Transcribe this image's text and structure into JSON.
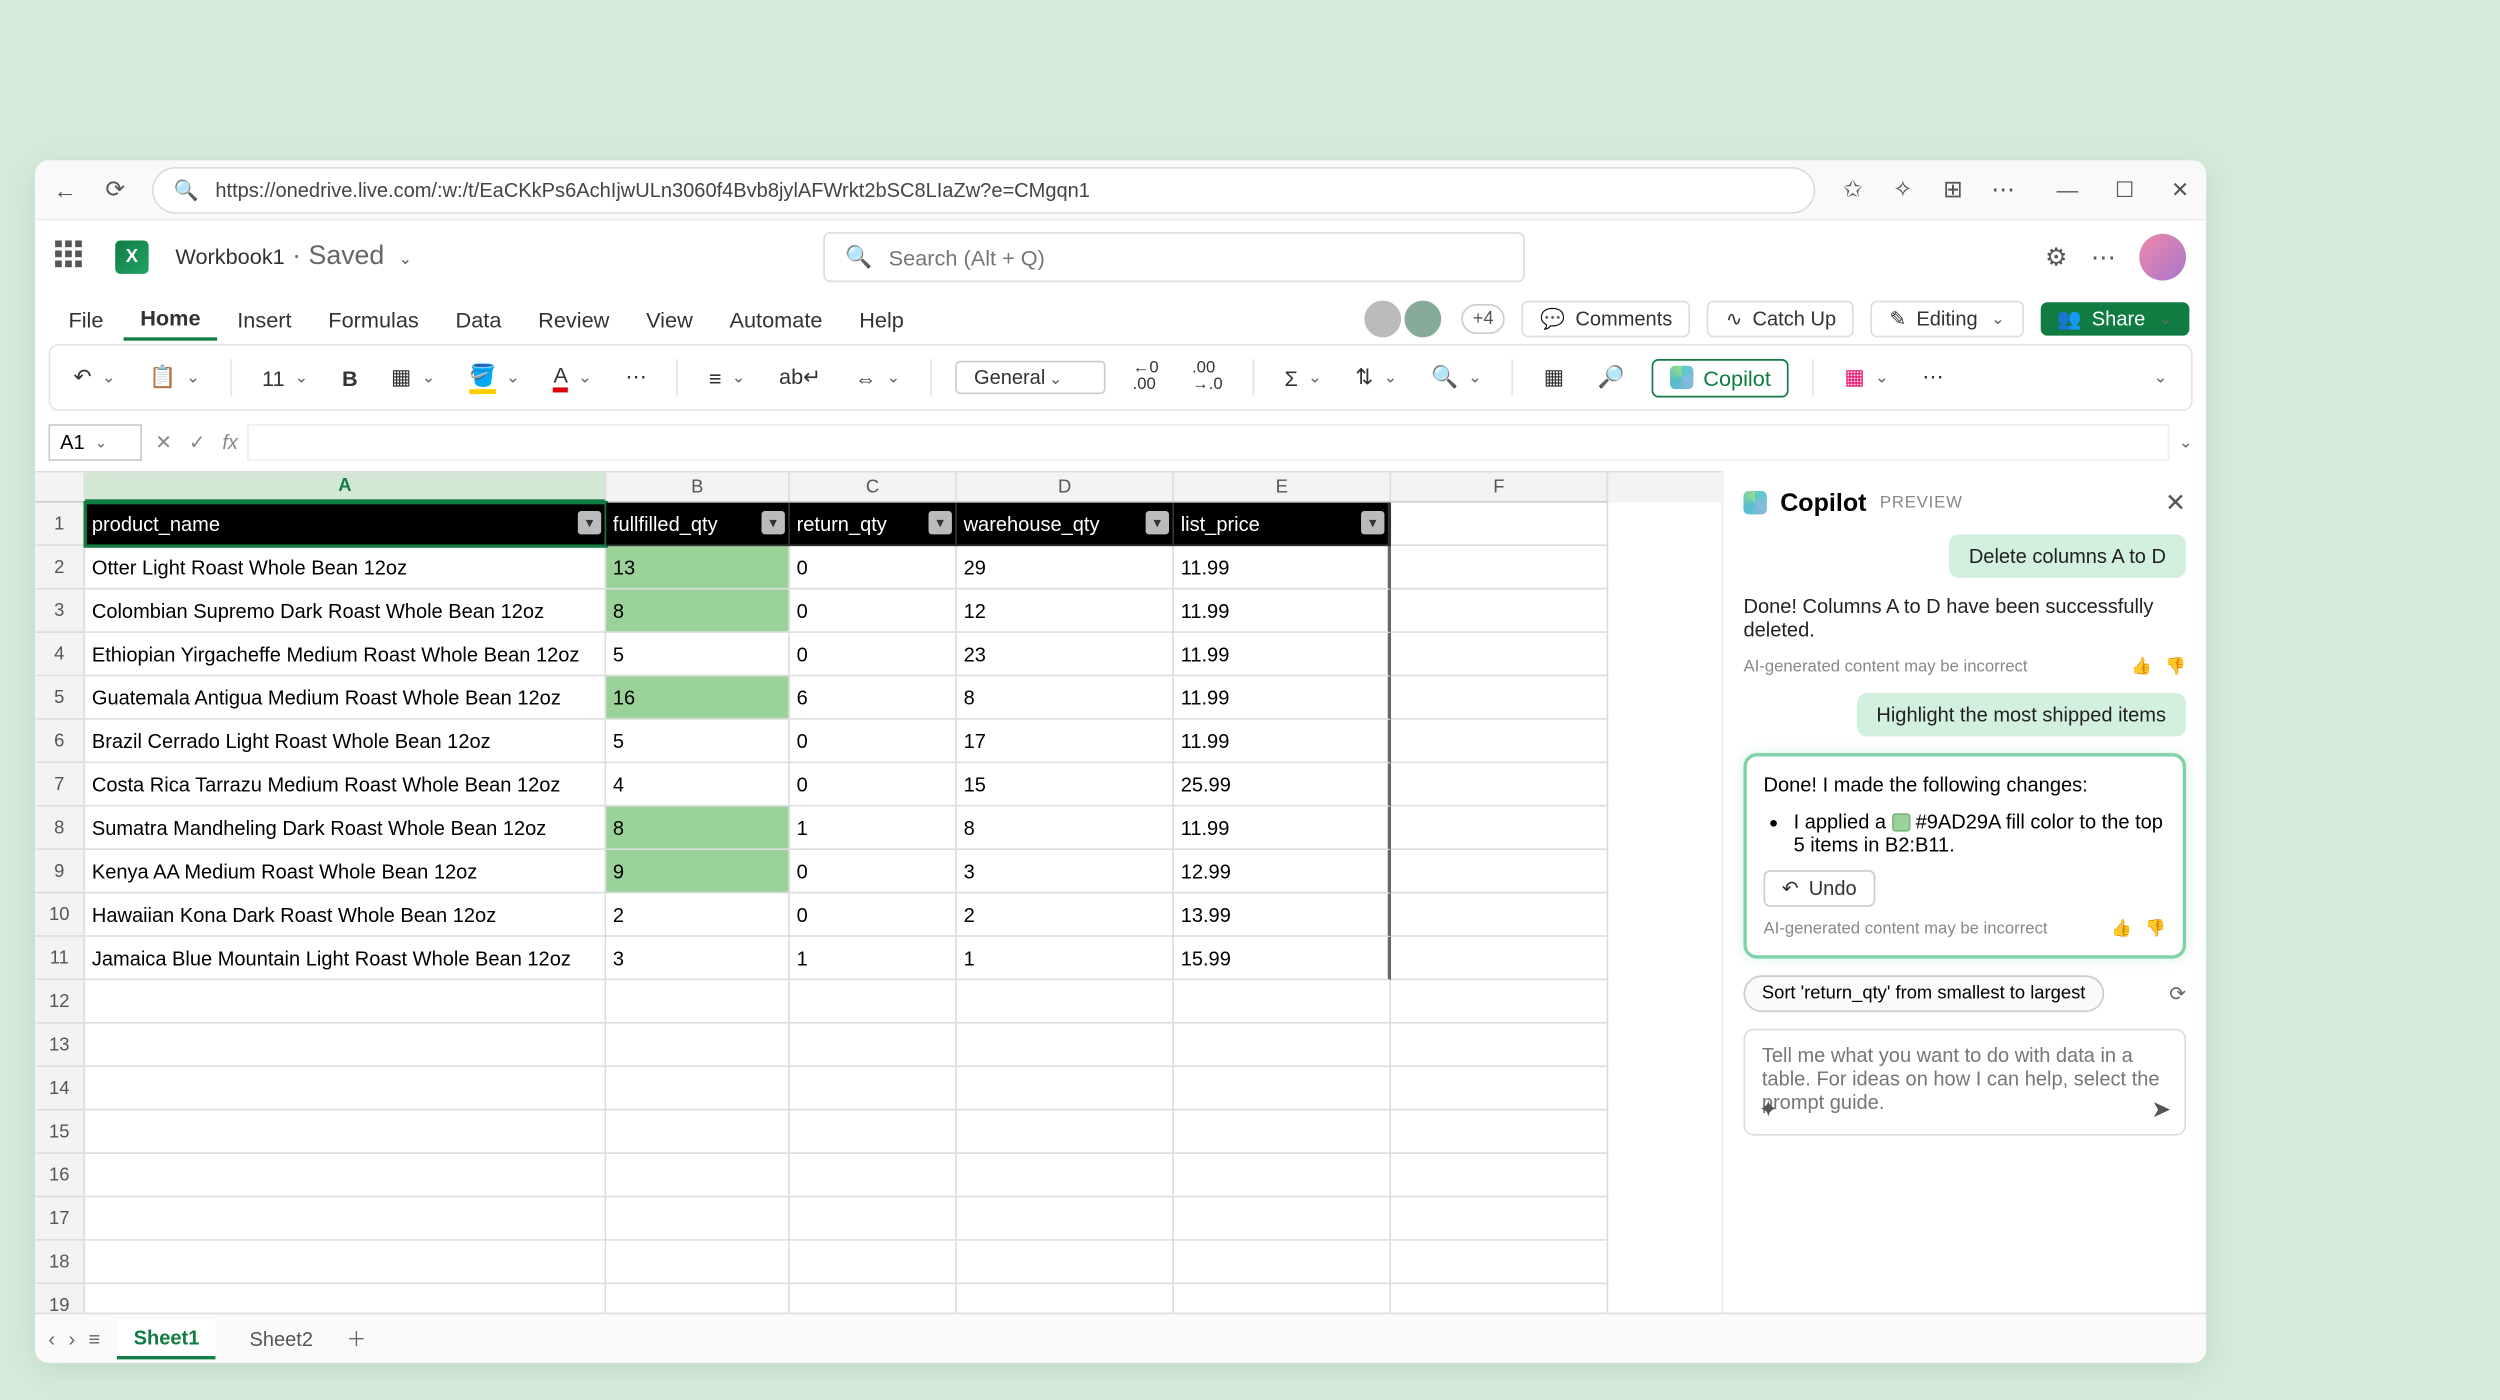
{
  "browser": {
    "url": "https://onedrive.live.com/:w:/t/EaCKkPs6AchIjwULn3060f4Bvb8jylAFWrkt2bSC8LIaZw?e=CMgqn1"
  },
  "title": {
    "doc": "Workbook1",
    "status": " · Saved",
    "search_placeholder": "Search (Alt + Q)"
  },
  "tabs": [
    "File",
    "Home",
    "Insert",
    "Formulas",
    "Data",
    "Review",
    "View",
    "Automate",
    "Help"
  ],
  "presence_extra": "+4",
  "actions": {
    "comments": "Comments",
    "catchup": "Catch Up",
    "editing": "Editing",
    "share": "Share"
  },
  "toolbar": {
    "font_size": "11",
    "number_format": "General",
    "copilot": "Copilot"
  },
  "namebox": "A1",
  "columns": [
    "A",
    "B",
    "C",
    "D",
    "E",
    "F"
  ],
  "headers": [
    "product_name",
    "fullfilled_qty",
    "return_qty",
    "warehouse_qty",
    "list_price"
  ],
  "rows": [
    {
      "n": "1"
    },
    {
      "n": "2",
      "a": "Otter Light Roast Whole Bean 12oz",
      "b": "13",
      "c": "0",
      "d": "29",
      "e": "11.99",
      "hl": true
    },
    {
      "n": "3",
      "a": "Colombian Supremo Dark Roast Whole Bean 12oz",
      "b": "8",
      "c": "0",
      "d": "12",
      "e": "11.99",
      "hl": true
    },
    {
      "n": "4",
      "a": "Ethiopian Yirgacheffe Medium Roast Whole Bean 12oz",
      "b": "5",
      "c": "0",
      "d": "23",
      "e": "11.99"
    },
    {
      "n": "5",
      "a": "Guatemala Antigua Medium Roast Whole Bean 12oz",
      "b": "16",
      "c": "6",
      "d": "8",
      "e": "11.99",
      "hl": true
    },
    {
      "n": "6",
      "a": "Brazil Cerrado Light Roast Whole Bean 12oz",
      "b": "5",
      "c": "0",
      "d": "17",
      "e": "11.99"
    },
    {
      "n": "7",
      "a": "Costa Rica Tarrazu Medium Roast Whole Bean 12oz",
      "b": "4",
      "c": "0",
      "d": "15",
      "e": "25.99"
    },
    {
      "n": "8",
      "a": "Sumatra Mandheling Dark Roast Whole Bean 12oz",
      "b": "8",
      "c": "1",
      "d": "8",
      "e": "11.99",
      "hl": true
    },
    {
      "n": "9",
      "a": "Kenya AA Medium Roast Whole Bean 12oz",
      "b": "9",
      "c": "0",
      "d": "3",
      "e": "12.99",
      "hl": true
    },
    {
      "n": "10",
      "a": "Hawaiian Kona Dark Roast Whole Bean 12oz",
      "b": "2",
      "c": "0",
      "d": "2",
      "e": "13.99"
    },
    {
      "n": "11",
      "a": "Jamaica Blue Mountain Light Roast Whole Bean 12oz",
      "b": "3",
      "c": "1",
      "d": "1",
      "e": "15.99"
    },
    {
      "n": "12"
    },
    {
      "n": "13"
    },
    {
      "n": "14"
    },
    {
      "n": "15"
    },
    {
      "n": "16"
    },
    {
      "n": "17"
    },
    {
      "n": "18"
    },
    {
      "n": "19"
    }
  ],
  "copilot": {
    "title": "Copilot",
    "preview": "PREVIEW",
    "user1": "Delete columns A to D",
    "ai1": "Done! Columns A to D have been successfully deleted.",
    "disclaimer": "AI-generated content may be incorrect",
    "user2": "Highlight the most shipped items",
    "ai2_lead": "Done! I made the following changes:",
    "ai2_bullet_pre": "I applied a ",
    "ai2_color": "#9AD29A",
    "ai2_bullet_post": " fill color to the top 5 items in B2:B11.",
    "undo": "Undo",
    "sugg": "Sort 'return_qty' from smallest to largest",
    "placeholder": "Tell me what you want to do with data in a table. For ideas on how I can help, select the prompt guide."
  },
  "sheets": [
    "Sheet1",
    "Sheet2"
  ]
}
